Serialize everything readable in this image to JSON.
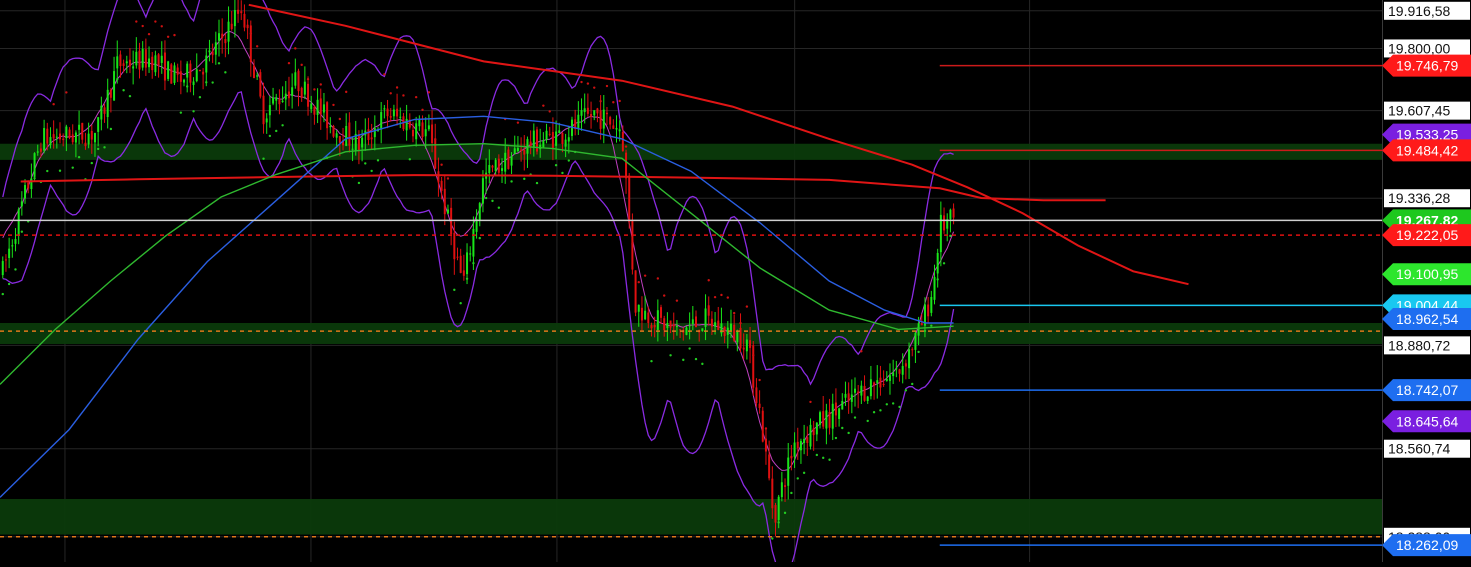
{
  "chart_data": {
    "type": "line",
    "title": "",
    "colors": {
      "background": "#000000",
      "grid": "#262626",
      "bull": "#19e619",
      "bear": "#e01010",
      "ma_red": "#e01515",
      "ma_blue": "#2a5ee0",
      "ma_green": "#2fb82f",
      "bollinger": "#8a2be2",
      "sar_bull": "#22cc22",
      "sar_bear": "#cc1111",
      "zone": "#0b3a0b",
      "dash_orange": "#e0791a"
    },
    "y_axis": {
      "min": 18210,
      "max": 19950,
      "labels": [
        {
          "text": "19.916,58",
          "value": 19916.58,
          "style": "plain"
        },
        {
          "text": "19.800,00",
          "value": 19800.0,
          "style": "plain"
        },
        {
          "text": "19.746,79",
          "value": 19746.79,
          "style": "tag",
          "color": "#ff1a1a",
          "text_color": "#ffffff"
        },
        {
          "text": "19.607,45",
          "value": 19607.45,
          "style": "plain"
        },
        {
          "text": "19.533,25",
          "value": 19533.25,
          "style": "tag",
          "color": "#7a1fe0",
          "text_color": "#ffffff"
        },
        {
          "text": "19.484,42",
          "value": 19484.42,
          "style": "tag",
          "color": "#ff1a1a",
          "text_color": "#ffffff"
        },
        {
          "text": "19.336,28",
          "value": 19336.28,
          "style": "plain"
        },
        {
          "text": "19.267,82",
          "value": 19267.82,
          "style": "tag",
          "color": "#1ec81e",
          "text_color": "#ffffff",
          "bold": true
        },
        {
          "text": "19.222,05",
          "value": 19222.05,
          "style": "tag",
          "color": "#ff1a1a",
          "text_color": "#ffffff"
        },
        {
          "text": "19.100,95",
          "value": 19100.95,
          "style": "tag",
          "color": "#2de62d",
          "text_color": "#ffffff"
        },
        {
          "text": "19.004,44",
          "value": 19004.44,
          "style": "tag",
          "color": "#19c8f0",
          "text_color": "#ffffff"
        },
        {
          "text": "18.962,54",
          "value": 18962.54,
          "style": "tag",
          "color": "#1e6ef0",
          "text_color": "#ffffff"
        },
        {
          "text": "18.880,72",
          "value": 18880.72,
          "style": "plain"
        },
        {
          "text": "18.742,07",
          "value": 18742.07,
          "style": "tag",
          "color": "#1e6ef0",
          "text_color": "#ffffff"
        },
        {
          "text": "18.645,64",
          "value": 18645.64,
          "style": "tag",
          "color": "#7a1fe0",
          "text_color": "#ffffff"
        },
        {
          "text": "18.560,74",
          "value": 18560.74,
          "style": "plain"
        },
        {
          "text": "18.288,00",
          "value": 18288.0,
          "style": "plain"
        },
        {
          "text": "18.262,09",
          "value": 18262.09,
          "style": "tag",
          "color": "#1e6ef0",
          "text_color": "#ffffff"
        }
      ]
    },
    "zones": [
      {
        "from": 19455,
        "to": 19505
      },
      {
        "from": 18885,
        "to": 18950
      },
      {
        "from": 18295,
        "to": 18405
      }
    ],
    "levels": [
      {
        "value": 19746.79,
        "color": "#cc1a1a",
        "x_from": 0.68,
        "dash": false
      },
      {
        "value": 19484.42,
        "color": "#cc1a1a",
        "x_from": 0.68,
        "dash": false
      },
      {
        "value": 19004.44,
        "color": "#19c8f0",
        "x_from": 0.68,
        "dash": false
      },
      {
        "value": 18742.07,
        "color": "#1e6ef0",
        "x_from": 0.68,
        "dash": false
      },
      {
        "value": 18262.09,
        "color": "#1e6ef0",
        "x_from": 0.68,
        "dash": false
      },
      {
        "value": 19267.82,
        "color": "#cfcfcf",
        "x_from": 0.0,
        "dash": false
      },
      {
        "value": 19222.05,
        "color": "#e01010",
        "x_from": 0.0,
        "dash": true
      },
      {
        "value": 18925,
        "color": "#e0791a",
        "x_from": 0.0,
        "dash": true
      },
      {
        "value": 18288,
        "color": "#e0791a",
        "x_from": 0.0,
        "dash": true
      }
    ],
    "series": [
      {
        "key": "ma_red",
        "x": [
          0.015,
          0.1,
          0.2,
          0.3,
          0.4,
          0.5,
          0.6,
          0.68,
          0.71,
          0.755,
          0.8
        ],
        "y": [
          19388,
          19395,
          19402,
          19408,
          19406,
          19400,
          19393,
          19367,
          19337,
          19330,
          19330
        ]
      },
      {
        "key": "ma_red",
        "x": [
          0.18,
          0.25,
          0.35,
          0.45,
          0.53,
          0.6,
          0.66,
          0.7,
          0.74,
          0.78,
          0.82,
          0.86
        ],
        "y": [
          19935,
          19870,
          19760,
          19700,
          19620,
          19520,
          19440,
          19370,
          19290,
          19190,
          19110,
          19070
        ]
      },
      {
        "key": "ma_blue",
        "x": [
          0.0,
          0.05,
          0.1,
          0.15,
          0.2,
          0.25,
          0.3,
          0.35,
          0.4,
          0.45,
          0.5,
          0.55,
          0.6,
          0.64,
          0.67,
          0.69
        ],
        "y": [
          18410,
          18620,
          18900,
          19140,
          19330,
          19520,
          19580,
          19590,
          19570,
          19520,
          19420,
          19260,
          19080,
          18990,
          18950,
          18950
        ]
      },
      {
        "key": "ma_green",
        "x": [
          0.0,
          0.04,
          0.08,
          0.12,
          0.16,
          0.2,
          0.25,
          0.3,
          0.35,
          0.4,
          0.45,
          0.5,
          0.55,
          0.6,
          0.65,
          0.69
        ],
        "y": [
          18760,
          18930,
          19080,
          19220,
          19340,
          19410,
          19480,
          19500,
          19505,
          19490,
          19460,
          19290,
          19120,
          18990,
          18930,
          18940
        ]
      }
    ],
    "candles": {
      "count": 300,
      "x_start": 0.002,
      "x_end": 0.69,
      "anchors": [
        [
          0.0,
          19080
        ],
        [
          0.03,
          19520
        ],
        [
          0.07,
          19540
        ],
        [
          0.085,
          19750
        ],
        [
          0.11,
          19770
        ],
        [
          0.13,
          19700
        ],
        [
          0.15,
          19760
        ],
        [
          0.175,
          19930
        ],
        [
          0.19,
          19600
        ],
        [
          0.215,
          19700
        ],
        [
          0.24,
          19560
        ],
        [
          0.26,
          19500
        ],
        [
          0.28,
          19600
        ],
        [
          0.31,
          19540
        ],
        [
          0.325,
          19250
        ],
        [
          0.335,
          19070
        ],
        [
          0.35,
          19400
        ],
        [
          0.38,
          19500
        ],
        [
          0.41,
          19540
        ],
        [
          0.43,
          19600
        ],
        [
          0.45,
          19550
        ],
        [
          0.46,
          19000
        ],
        [
          0.49,
          18920
        ],
        [
          0.51,
          18960
        ],
        [
          0.54,
          18900
        ],
        [
          0.55,
          18670
        ],
        [
          0.56,
          18350
        ],
        [
          0.575,
          18580
        ],
        [
          0.6,
          18660
        ],
        [
          0.63,
          18760
        ],
        [
          0.65,
          18800
        ],
        [
          0.665,
          18920
        ],
        [
          0.675,
          19050
        ],
        [
          0.68,
          19250
        ],
        [
          0.69,
          19268
        ]
      ],
      "volatility": 55
    },
    "bollinger": {
      "x_end": 0.695,
      "offsets": [
        [
          0.0,
          180
        ],
        [
          0.08,
          190
        ],
        [
          0.17,
          220
        ],
        [
          0.24,
          160
        ],
        [
          0.32,
          230
        ],
        [
          0.42,
          150
        ],
        [
          0.47,
          310
        ],
        [
          0.55,
          300
        ],
        [
          0.6,
          170
        ],
        [
          0.66,
          150
        ],
        [
          0.69,
          330
        ]
      ]
    }
  }
}
